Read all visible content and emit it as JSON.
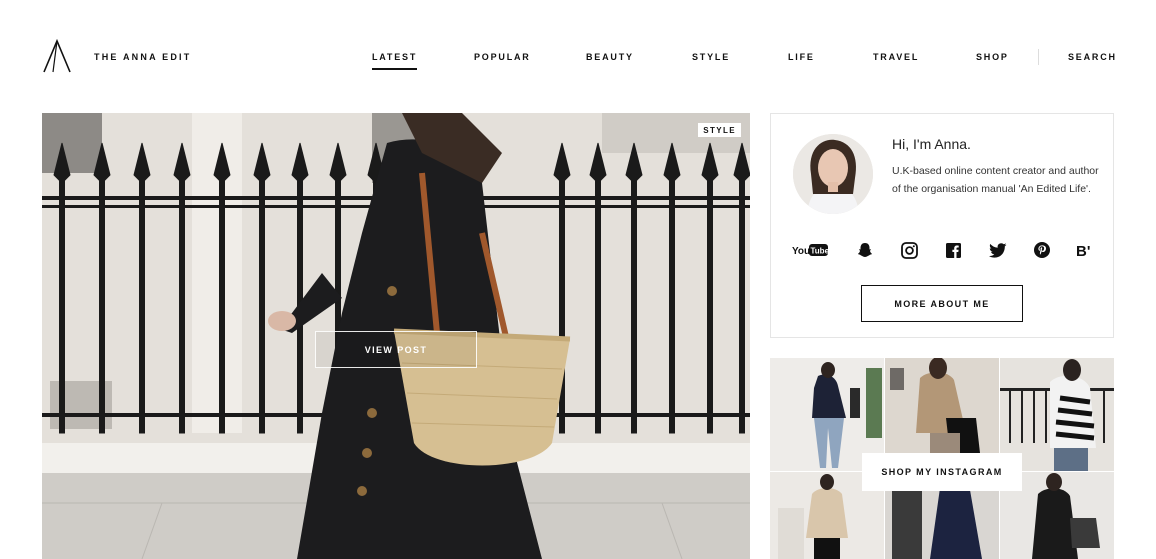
{
  "header": {
    "brand": "THE ANNA EDIT",
    "nav": [
      {
        "label": "LATEST",
        "active": true
      },
      {
        "label": "POPULAR",
        "active": false
      },
      {
        "label": "BEAUTY",
        "active": false
      },
      {
        "label": "STYLE",
        "active": false
      },
      {
        "label": "LIFE",
        "active": false
      },
      {
        "label": "TRAVEL",
        "active": false
      },
      {
        "label": "SHOP",
        "active": false
      },
      {
        "label": "SEARCH",
        "active": false
      }
    ]
  },
  "hero": {
    "category_tag": "STYLE",
    "view_post_label": "VIEW POST"
  },
  "about": {
    "greeting": "Hi, I'm Anna.",
    "bio": "U.K-based online content creator and author of the organisation manual 'An Edited Life'.",
    "more_label": "MORE ABOUT ME",
    "socials": [
      {
        "icon": "youtube-icon",
        "label": "YouTube"
      },
      {
        "icon": "snapchat-icon"
      },
      {
        "icon": "instagram-icon"
      },
      {
        "icon": "facebook-icon"
      },
      {
        "icon": "twitter-icon"
      },
      {
        "icon": "pinterest-icon"
      },
      {
        "icon": "bloglovin-icon",
        "label": "B'"
      }
    ]
  },
  "instagram": {
    "button_label": "SHOP MY INSTAGRAM"
  },
  "colors": {
    "text": "#111111",
    "border": "#e5e5e5",
    "background": "#ffffff"
  }
}
